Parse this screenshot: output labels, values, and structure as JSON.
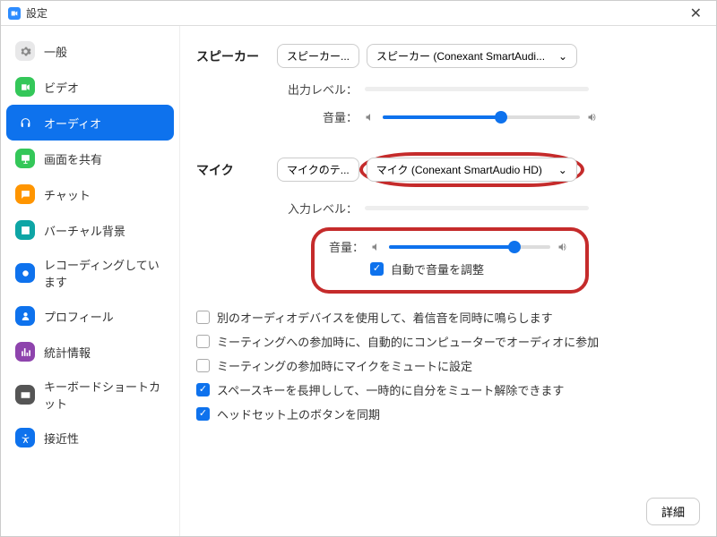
{
  "window": {
    "title": "設定"
  },
  "sidebar": {
    "items": [
      {
        "label": "一般",
        "icon": "gear-icon",
        "bg": "#e8e8e9"
      },
      {
        "label": "ビデオ",
        "icon": "video-icon",
        "bg": "#34c759"
      },
      {
        "label": "オーディオ",
        "icon": "headphones-icon",
        "bg": "#0e72ed",
        "active": true
      },
      {
        "label": "画面を共有",
        "icon": "share-icon",
        "bg": "#34c759"
      },
      {
        "label": "チャット",
        "icon": "chat-icon",
        "bg": "#ff9500"
      },
      {
        "label": "バーチャル背景",
        "icon": "virtual-bg-icon",
        "bg": "#0ea5a5"
      },
      {
        "label": "レコーディングしています",
        "icon": "record-icon",
        "bg": "#0e72ed"
      },
      {
        "label": "プロフィール",
        "icon": "profile-icon",
        "bg": "#0e72ed"
      },
      {
        "label": "統計情報",
        "icon": "stats-icon",
        "bg": "#8e44ad"
      },
      {
        "label": "キーボードショートカット",
        "icon": "keyboard-icon",
        "bg": "#555"
      },
      {
        "label": "接近性",
        "icon": "accessibility-icon",
        "bg": "#0e72ed"
      }
    ]
  },
  "speaker": {
    "section_label": "スピーカー",
    "test_label": "スピーカー...",
    "device": "スピーカー (Conexant SmartAudi...",
    "output_level_label": "出力レベル：",
    "volume_label": "音量：",
    "volume_pct": 60
  },
  "mic": {
    "section_label": "マイク",
    "test_label": "マイクのテ...",
    "device": "マイク (Conexant SmartAudio HD)",
    "input_level_label": "入力レベル：",
    "volume_label": "音量：",
    "volume_pct": 78,
    "auto_adjust_label": "自動で音量を調整",
    "auto_adjust_checked": true
  },
  "options": [
    {
      "label": "別のオーディオデバイスを使用して、着信音を同時に鳴らします",
      "checked": false
    },
    {
      "label": "ミーティングへの参加時に、自動的にコンピューターでオーディオに参加",
      "checked": false
    },
    {
      "label": "ミーティングの参加時にマイクをミュートに設定",
      "checked": false
    },
    {
      "label": "スペースキーを長押しして、一時的に自分をミュート解除できます",
      "checked": true
    },
    {
      "label": "ヘッドセット上のボタンを同期",
      "checked": true
    }
  ],
  "advanced_label": "詳細"
}
